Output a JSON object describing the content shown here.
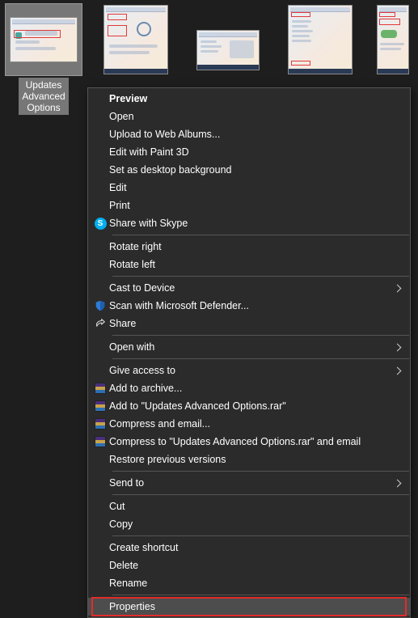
{
  "thumbnails": {
    "selected_label": "Updates\nAdvanced\nOptions"
  },
  "menu": {
    "preview": "Preview",
    "open": "Open",
    "upload": "Upload to Web Albums...",
    "paint3d": "Edit with Paint 3D",
    "wallpaper": "Set as desktop background",
    "edit": "Edit",
    "print": "Print",
    "skype": "Share with Skype",
    "rotate_right": "Rotate right",
    "rotate_left": "Rotate left",
    "cast": "Cast to Device",
    "defender": "Scan with Microsoft Defender...",
    "share": "Share",
    "open_with": "Open with",
    "give_access": "Give access to",
    "add_archive": "Add to archive...",
    "add_rar": "Add to \"Updates Advanced Options.rar\"",
    "compress_email": "Compress and email...",
    "compress_rar_email": "Compress to \"Updates Advanced Options.rar\" and email",
    "restore": "Restore previous versions",
    "send_to": "Send to",
    "cut": "Cut",
    "copy": "Copy",
    "create_shortcut": "Create shortcut",
    "delete": "Delete",
    "rename": "Rename",
    "properties": "Properties"
  }
}
